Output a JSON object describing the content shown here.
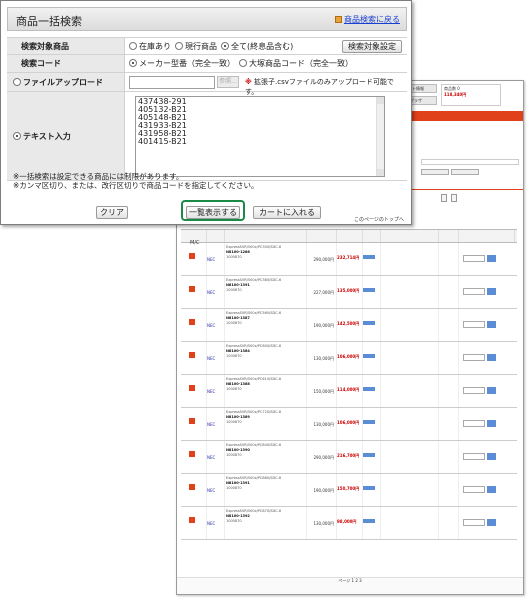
{
  "dialog": {
    "title": "商品一括検索",
    "back_link": "商品検索に戻る",
    "rows": {
      "target": {
        "label": "検索対象商品",
        "options": [
          "在庫あり",
          "現行商品",
          "全て(終息品含む)"
        ],
        "selected": 2,
        "setting_button": "検索対象設定"
      },
      "code": {
        "label": "検索コード",
        "options": [
          "メーカー型番（完全一致）",
          "大塚商品コード（完全一致）"
        ],
        "selected": 0
      },
      "upload": {
        "label": "ファイルアップロード",
        "ref_button": "参照...",
        "warning_prefix": "※",
        "warning_text": "拡張子.csvファイルのみアップロード可能です。"
      },
      "text": {
        "label": "テキスト入力",
        "lines": [
          "437438-291",
          "405132-B21",
          "405148-B21",
          "431933-B21",
          "431958-B21",
          "401415-B21"
        ]
      }
    },
    "notes": [
      "※一括検索は設定できる商品には制限があります。",
      "※カンマ区切り、または、改行区切りで商品コードを指定してください。"
    ],
    "buttons": {
      "clear": "クリア",
      "list": "一覧表示する",
      "cart": "カートに入れる"
    }
  },
  "bg_page": {
    "cart_btn": "カート情報",
    "my_btn": "Myプラザ",
    "cart_info": "商品数 0",
    "cart_total": "118,340円",
    "nav": [
      "サポート",
      "ログアウト"
    ],
    "top_link": "このページのトップへ",
    "maker": "M/C",
    "page_label": "ページ 1 2 3",
    "maker_name": "NEC",
    "rows": [
      {
        "spec": "ExpressSVR/500x/PC300/SDC-6",
        "model": "N8100-1286",
        "code": "1000870",
        "price": "290,000円",
        "sale": "232,714円"
      },
      {
        "spec": "ExpressSVR/500x/PC380/SDC-6",
        "model": "N8100-1391",
        "code": "1000870",
        "price": "227,000円",
        "sale": "135,000円"
      },
      {
        "spec": "ExpressSVR/500x/PC560/SDC-6",
        "model": "N8100-1387",
        "code": "1000870",
        "price": "190,000円",
        "sale": "142,500円"
      },
      {
        "spec": "ExpressSVR/500x/PC600/SDC-6",
        "model": "N8100-1384",
        "code": "1000870",
        "price": "130,000円",
        "sale": "106,000円"
      },
      {
        "spec": "ExpressSVR/500x/PC610/SDC-6",
        "model": "N8100-1388",
        "code": "1000870",
        "price": "150,000円",
        "sale": "114,000円"
      },
      {
        "spec": "ExpressSVR/500x/PC720/SDC-6",
        "model": "N8100-1389",
        "code": "1000870",
        "price": "130,000円",
        "sale": "106,000円"
      },
      {
        "spec": "ExpressSVR/500x/PC840/SDC-6",
        "model": "N8100-1390",
        "code": "1000870",
        "price": "290,000円",
        "sale": "216,700円"
      },
      {
        "spec": "ExpressSVR/500x/PC860/SDC-6",
        "model": "N8100-1391",
        "code": "1000870",
        "price": "190,000円",
        "sale": "150,700円"
      },
      {
        "spec": "ExpressSVR/500x/PC870/SDC-6",
        "model": "N8100-1392",
        "code": "1000870",
        "price": "130,000円",
        "sale": "98,000円"
      }
    ]
  }
}
